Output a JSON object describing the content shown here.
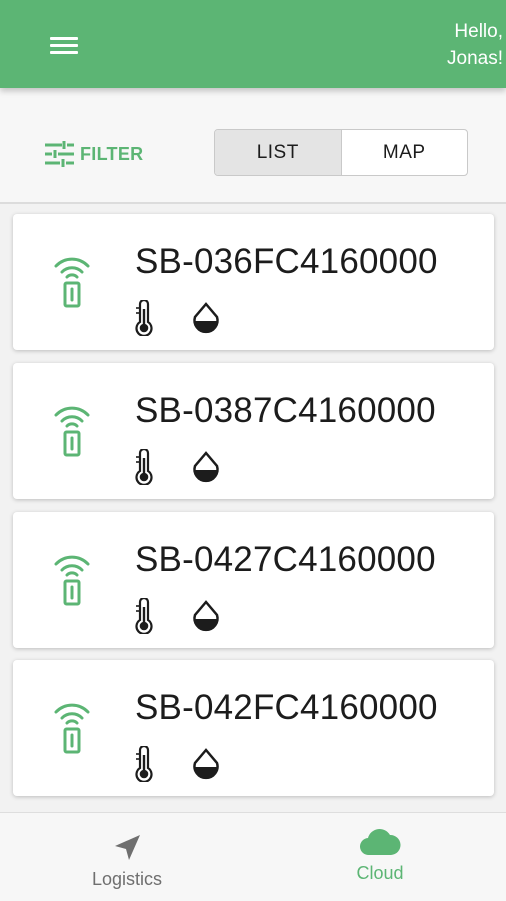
{
  "header": {
    "greeting_line1": "Hello,",
    "greeting_line2": "Jonas!",
    "accent_color": "#5cb574",
    "menu_icon": "hamburger-menu-icon"
  },
  "toolbar": {
    "filter_label": "FILTER",
    "filter_icon": "sliders-icon",
    "view_toggle": {
      "options": [
        "LIST",
        "MAP"
      ],
      "selected": "LIST"
    }
  },
  "devices": [
    {
      "id": "SB-036FC4160000",
      "icons": [
        "wireless-sensor-icon",
        "thermometer-icon",
        "humidity-drop-icon"
      ]
    },
    {
      "id": "SB-0387C4160000",
      "icons": [
        "wireless-sensor-icon",
        "thermometer-icon",
        "humidity-drop-icon"
      ]
    },
    {
      "id": "SB-0427C4160000",
      "icons": [
        "wireless-sensor-icon",
        "thermometer-icon",
        "humidity-drop-icon"
      ]
    },
    {
      "id": "SB-042FC4160000",
      "icons": [
        "wireless-sensor-icon",
        "thermometer-icon",
        "humidity-drop-icon"
      ]
    }
  ],
  "bottom_nav": {
    "items": [
      {
        "label": "Logistics",
        "icon": "navigation-arrow-icon",
        "active": false
      },
      {
        "label": "Cloud",
        "icon": "cloud-icon",
        "active": true
      }
    ],
    "active_color": "#5cb574",
    "inactive_color": "#6f6f6f"
  }
}
